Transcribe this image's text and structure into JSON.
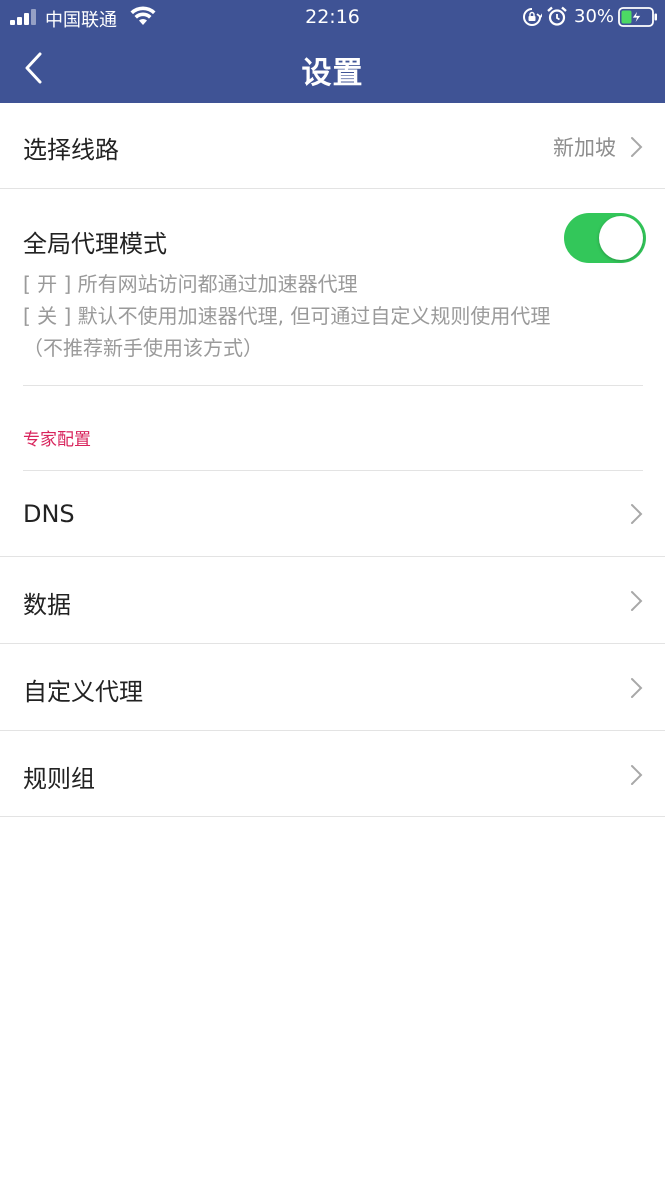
{
  "status_bar": {
    "carrier": "中国联通",
    "time": "22:16",
    "battery": "30%"
  },
  "nav": {
    "title": "设置"
  },
  "route": {
    "label": "选择线路",
    "value": "新加坡"
  },
  "global_proxy": {
    "label": "全局代理模式",
    "enabled": true,
    "desc_on": "[ 开 ] 所有网站访问都通过加速器代理",
    "desc_off": "[ 关 ] 默认不使用加速器代理, 但可通过自定义规则使用代理",
    "desc_note": "（不推荐新手使用该方式）"
  },
  "expert": {
    "section_title": "专家配置",
    "items": [
      {
        "label": "DNS"
      },
      {
        "label": "数据"
      },
      {
        "label": "自定义代理"
      },
      {
        "label": "规则组"
      }
    ]
  },
  "colors": {
    "header": "#3f5395",
    "toggle_on": "#33c75a",
    "section_title": "#d8245c"
  },
  "icons": [
    "signal-icon",
    "wifi-icon",
    "rotation-lock-icon",
    "alarm-icon",
    "battery-charging-icon",
    "back-arrow-icon",
    "chevron-right-icon"
  ]
}
